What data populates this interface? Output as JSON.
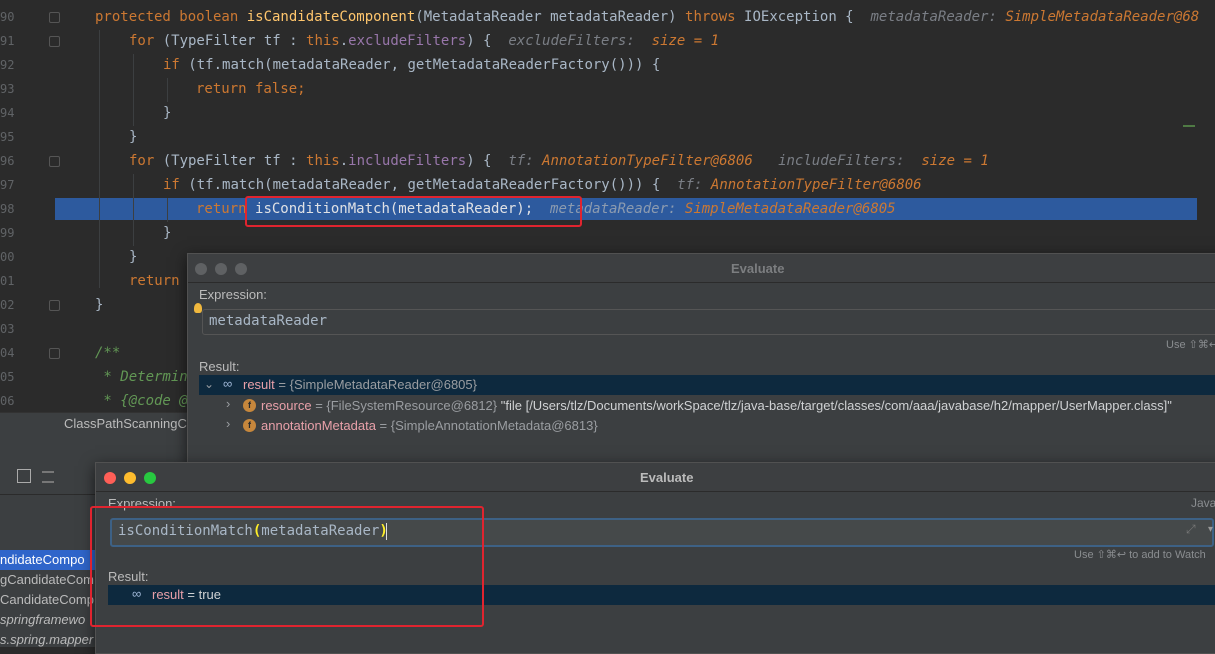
{
  "editor": {
    "line_numbers": [
      "90",
      "91",
      "92",
      "93",
      "94",
      "95",
      "96",
      "97",
      "98",
      "99",
      "00",
      "01",
      "02",
      "03",
      "04",
      "05",
      "06"
    ],
    "lines": {
      "l0": {
        "kw1": "protected boolean ",
        "fn": "isCandidateComponent",
        "rest": "(MetadataReader metadataReader) ",
        "kw2": "throws ",
        "rest2": "IOException {",
        "hint": "metadataReader: ",
        "hintv": "SimpleMetadataReader@68"
      },
      "l1": {
        "kw": "for ",
        "rest": "(TypeFilter tf : ",
        "this": "this",
        ".": ".",
        "fld": "excludeFilters",
        "rest2": ") {",
        "hint": "excludeFilters:  ",
        "hintv": "size = 1"
      },
      "l2": {
        "kw": "if ",
        "rest": "(tf.match(metadataReader, getMetadataReaderFactory())) {"
      },
      "l3": {
        "kw": "return false;"
      },
      "l4": {
        "rest": "}"
      },
      "l5": {
        "rest": "}"
      },
      "l6": {
        "kw": "for ",
        "rest": "(TypeFilter tf : ",
        "this": "this",
        "fld": "includeFilters",
        "rest2": ") {",
        "hint1": "tf: ",
        "hintv1": "AnnotationTypeFilter@6806",
        "hint2": "includeFilters:  ",
        "hintv2": "size = 1"
      },
      "l7": {
        "kw": "if ",
        "rest": "(tf.match(metadataReader, getMetadataReaderFactory())) {",
        "hint": "tf: ",
        "hintv": "AnnotationTypeFilter@6806"
      },
      "l8": {
        "kw": "return ",
        "rest": "isConditionMatch(metadataReader);",
        "hint": "metadataReader: ",
        "hintv": "SimpleMetadataReader@6805"
      },
      "l9": {
        "rest": "}"
      },
      "l10": {
        "rest": "}"
      },
      "l11": {
        "kw": "return"
      },
      "l12": {
        "rest": "}"
      },
      "l14": {
        "cmt": "/**"
      },
      "l15": {
        "cmt": " * Determin"
      },
      "l16": {
        "cmt": " * {@code @"
      }
    }
  },
  "tabbar": {
    "file": "ClassPathScanningCa"
  },
  "frames": [
    "ndidateCompo",
    "gCandidateCom",
    "CandidateComp",
    "springframewo",
    "s.spring.mapper"
  ],
  "dialog1": {
    "title": "Evaluate",
    "expression_label": "Expression:",
    "expression_value": "metadataReader",
    "hint": "Use ⇧⌘↩",
    "result_label": "Result:",
    "result_name": "result",
    "result_value": " = {SimpleMetadataReader@6805}",
    "children": [
      {
        "name": "resource",
        "value": " = {FileSystemResource@6812} ",
        "extra": "\"file [/Users/tlz/Documents/workSpace/tlz/java-base/target/classes/com/aaa/javabase/h2/mapper/UserMapper.class]\""
      },
      {
        "name": "annotationMetadata",
        "value": " = {SimpleAnnotationMetadata@6813}",
        "extra": ""
      }
    ]
  },
  "dialog2": {
    "title": "Evaluate",
    "expression_label": "Expression:",
    "lang": "Java",
    "expression_fn": "isConditionMatch",
    "expression_open": "(",
    "expression_arg": "metadataReader",
    "expression_close": ")",
    "hint": "Use ⇧⌘↩ to add to Watch",
    "result_label": "Result:",
    "result_name": "result",
    "result_value": " = true"
  },
  "colors": {
    "highlight": "#2d5a9e",
    "red_annotation": "#e0242f",
    "close": "#ff5f57",
    "minimize": "#febc2e",
    "zoom": "#28c840"
  }
}
